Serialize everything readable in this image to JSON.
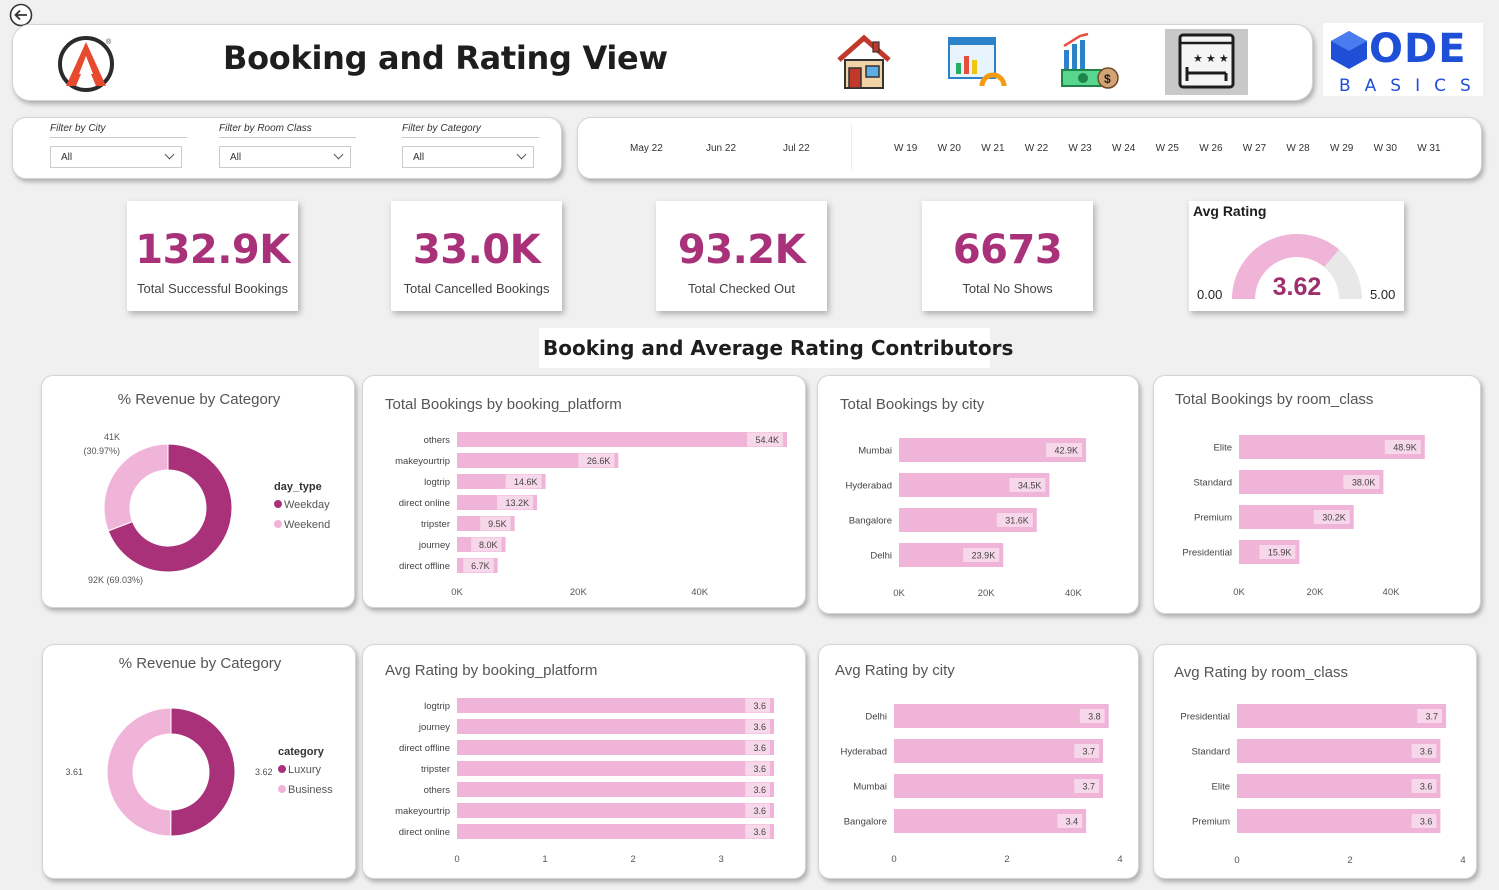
{
  "header": {
    "title": "Booking and Rating View",
    "brand_top": "ODE",
    "brand_bottom": "BASICS"
  },
  "filters": [
    {
      "label": "Filter by City",
      "value": "All"
    },
    {
      "label": "Filter by Room Class",
      "value": "All"
    },
    {
      "label": "Filter by Category",
      "value": "All"
    }
  ],
  "months": [
    "May 22",
    "Jun 22",
    "Jul 22"
  ],
  "weeks": [
    "W 19",
    "W 20",
    "W 21",
    "W 22",
    "W 23",
    "W 24",
    "W 25",
    "W 26",
    "W 27",
    "W 28",
    "W 29",
    "W 30",
    "W 31"
  ],
  "kpis": [
    {
      "value": "132.9K",
      "label": "Total Successful Bookings"
    },
    {
      "value": "33.0K",
      "label": "Total Cancelled Bookings"
    },
    {
      "value": "93.2K",
      "label": "Total Checked Out"
    },
    {
      "value": "6673",
      "label": "Total No Shows"
    }
  ],
  "section_title": "Booking and Average Rating Contributors",
  "colors": {
    "pink": "#f1b4d9",
    "purple": "#a8317a",
    "accent": "#9e2f6e",
    "brand_blue": "#1f4fd6"
  },
  "chart_data": [
    {
      "type": "gauge",
      "title": "Avg Rating",
      "value": 3.62,
      "value_label": "3.62",
      "min": 0,
      "max": 5,
      "min_label": "0.00",
      "max_label": "5.00"
    },
    {
      "type": "pie",
      "title": "% Revenue by Category",
      "legend_title": "day_type",
      "slices": [
        {
          "name": "Weekday",
          "value": 92,
          "label": "92K (69.03%)"
        },
        {
          "name": "Weekend",
          "value": 41,
          "label": "41K",
          "label2": "(30.97%)"
        }
      ]
    },
    {
      "type": "bar",
      "title": "Total Bookings by booking_platform",
      "categories": [
        "others",
        "makeyourtrip",
        "logtrip",
        "direct online",
        "tripster",
        "journey",
        "direct offline"
      ],
      "values": [
        54.4,
        26.6,
        14.6,
        13.2,
        9.5,
        8.0,
        6.7
      ],
      "value_labels": [
        "54.4K",
        "26.6K",
        "14.6K",
        "13.2K",
        "9.5K",
        "8.0K",
        "6.7K"
      ],
      "xticks": [
        "0K",
        "20K",
        "40K"
      ],
      "xlim": [
        0,
        60
      ]
    },
    {
      "type": "bar",
      "title": "Total Bookings by city",
      "categories": [
        "Mumbai",
        "Hyderabad",
        "Bangalore",
        "Delhi"
      ],
      "values": [
        42.9,
        34.5,
        31.6,
        23.9
      ],
      "value_labels": [
        "42.9K",
        "34.5K",
        "31.6K",
        "23.9K"
      ],
      "xticks": [
        "0K",
        "20K",
        "40K"
      ],
      "xlim": [
        0,
        50
      ]
    },
    {
      "type": "bar",
      "title": "Total Bookings by room_class",
      "categories": [
        "Elite",
        "Standard",
        "Premium",
        "Presidential"
      ],
      "values": [
        48.9,
        38.0,
        30.2,
        15.9
      ],
      "value_labels": [
        "48.9K",
        "38.0K",
        "30.2K",
        "15.9K"
      ],
      "xticks": [
        "0K",
        "20K",
        "40K"
      ],
      "xlim": [
        0,
        50
      ]
    },
    {
      "type": "pie",
      "title": "% Revenue by Category",
      "legend_title": "category",
      "slices": [
        {
          "name": "Luxury",
          "value": 3.62,
          "label": "3.62"
        },
        {
          "name": "Business",
          "value": 3.61,
          "label": "3.61"
        }
      ]
    },
    {
      "type": "bar",
      "title": "Avg Rating by booking_platform",
      "categories": [
        "logtrip",
        "journey",
        "direct offline",
        "tripster",
        "others",
        "makeyourtrip",
        "direct online"
      ],
      "values": [
        3.6,
        3.6,
        3.6,
        3.6,
        3.6,
        3.6,
        3.6
      ],
      "value_labels": [
        "3.6",
        "3.6",
        "3.6",
        "3.6",
        "3.6",
        "3.6",
        "3.6"
      ],
      "xticks": [
        "0",
        "1",
        "2",
        "3"
      ],
      "xlim": [
        0,
        3.6
      ]
    },
    {
      "type": "bar",
      "title": "Avg Rating by city",
      "categories": [
        "Delhi",
        "Hyderabad",
        "Mumbai",
        "Bangalore"
      ],
      "values": [
        3.8,
        3.7,
        3.7,
        3.4
      ],
      "value_labels": [
        "3.8",
        "3.7",
        "3.7",
        "3.4"
      ],
      "xticks": [
        "0",
        "2",
        "4"
      ],
      "xlim": [
        0,
        4
      ]
    },
    {
      "type": "bar",
      "title": "Avg Rating by room_class",
      "categories": [
        "Presidential",
        "Standard",
        "Elite",
        "Premium"
      ],
      "values": [
        3.7,
        3.6,
        3.6,
        3.6
      ],
      "value_labels": [
        "3.7",
        "3.6",
        "3.6",
        "3.6"
      ],
      "xticks": [
        "0",
        "2",
        "4"
      ],
      "xlim": [
        0,
        4
      ]
    }
  ]
}
